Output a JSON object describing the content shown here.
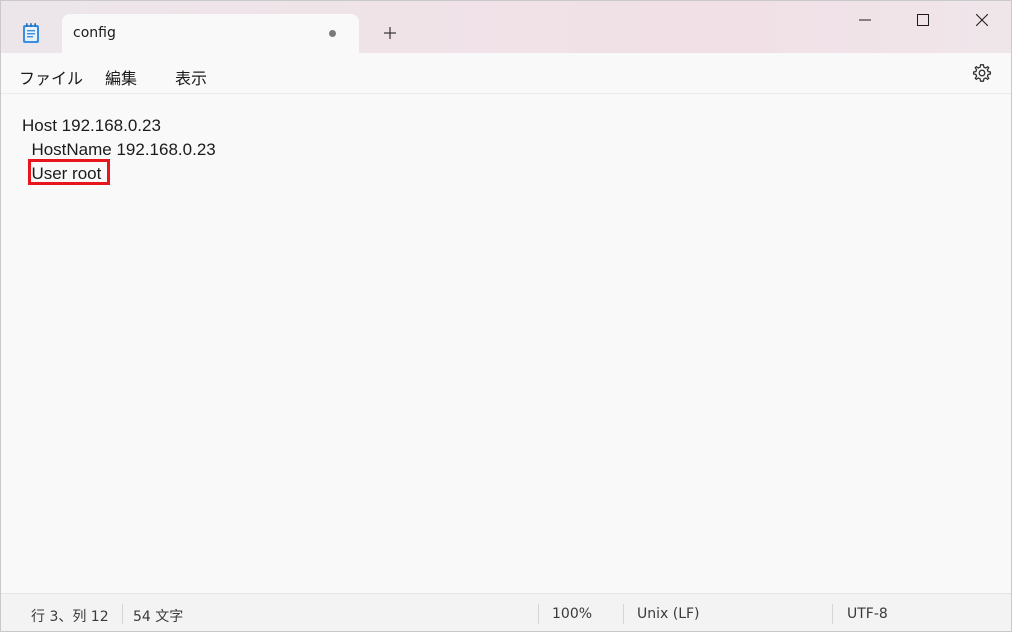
{
  "window": {
    "tab_title": "config",
    "new_tab_symbol": "+"
  },
  "menu": {
    "file": "ファイル",
    "edit": "編集",
    "view": "表示"
  },
  "editor": {
    "lines": [
      "Host 192.168.0.23",
      "  HostName 192.168.0.23",
      "  User root"
    ]
  },
  "status": {
    "position": "行 3、列 12",
    "char_count": "54 文字",
    "zoom": "100%",
    "line_ending": "Unix (LF)",
    "encoding": "UTF-8"
  },
  "colors": {
    "highlight": "#e8141e",
    "accent_icon": "#2b7bd1"
  },
  "icons": {
    "app": "notepad-icon",
    "settings": "gear-icon",
    "minimize": "minimize-icon",
    "maximize": "maximize-icon",
    "close": "close-icon",
    "unsaved": "unsaved-dot-icon"
  }
}
